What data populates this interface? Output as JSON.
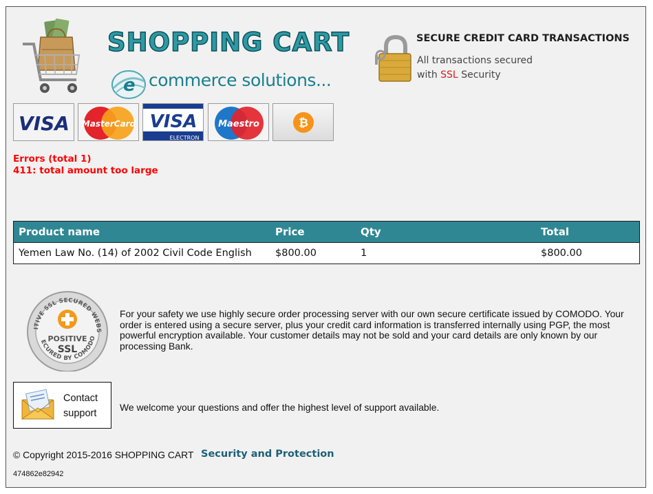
{
  "header": {
    "brand_title": "SHOPPING CART",
    "brand_subtitle": "commerce solutions...",
    "secure_title": "SECURE CREDIT CARD TRANSACTIONS",
    "secure_line1": "All transactions secured",
    "secure_line2_prefix": "with",
    "secure_line2_ssl": "SSL",
    "secure_line2_suffix": "Security"
  },
  "payment_cards": [
    {
      "name": "visa",
      "label": "VISA"
    },
    {
      "name": "mastercard",
      "label": "MasterCard"
    },
    {
      "name": "visa-electron",
      "label": "VISA",
      "sublabel": "ELECTRON"
    },
    {
      "name": "maestro",
      "label": "Maestro"
    },
    {
      "name": "bitcoin",
      "label": "₿"
    }
  ],
  "errors": {
    "title": "Errors (total 1)",
    "items": [
      "411: total amount too large"
    ]
  },
  "cart_table": {
    "columns": [
      "Product name",
      "Price",
      "Qty",
      "Total"
    ],
    "rows": [
      {
        "product": "Yemen Law No. (14) of 2002 Civil Code English",
        "price": "$800.00",
        "qty": "1",
        "total": "$800.00"
      }
    ]
  },
  "ssl_seal": {
    "top_text": "POSITIVE SSL SECURED WEBSITE",
    "bottom_text": "SECURED BY COMODO",
    "line1": "POSITIVE",
    "line2": "SSL"
  },
  "safety_text": "For your safety we use highly secure order processing server with our own secure certificate issued by COMODO. Your order is entered using a secure server, plus your credit card information is transferred internally using PGP, the most powerful encryption available. Your customer details may not be sold and your card details are only known by our processing Bank.",
  "contact": {
    "line1": "Contact",
    "line2": "support"
  },
  "welcome_text": "We welcome your questions and offer the highest level of support available.",
  "footer": {
    "copyright": "© Copyright 2015-2016 SHOPPING CART",
    "security_link": "Security and Protection",
    "session_id": "474862e82942"
  },
  "colors": {
    "table_header": "#2f8794",
    "error": "#ff0000",
    "brand": "#2d9aa5",
    "link": "#1d5f78",
    "ssl_red": "#d41c1c"
  }
}
